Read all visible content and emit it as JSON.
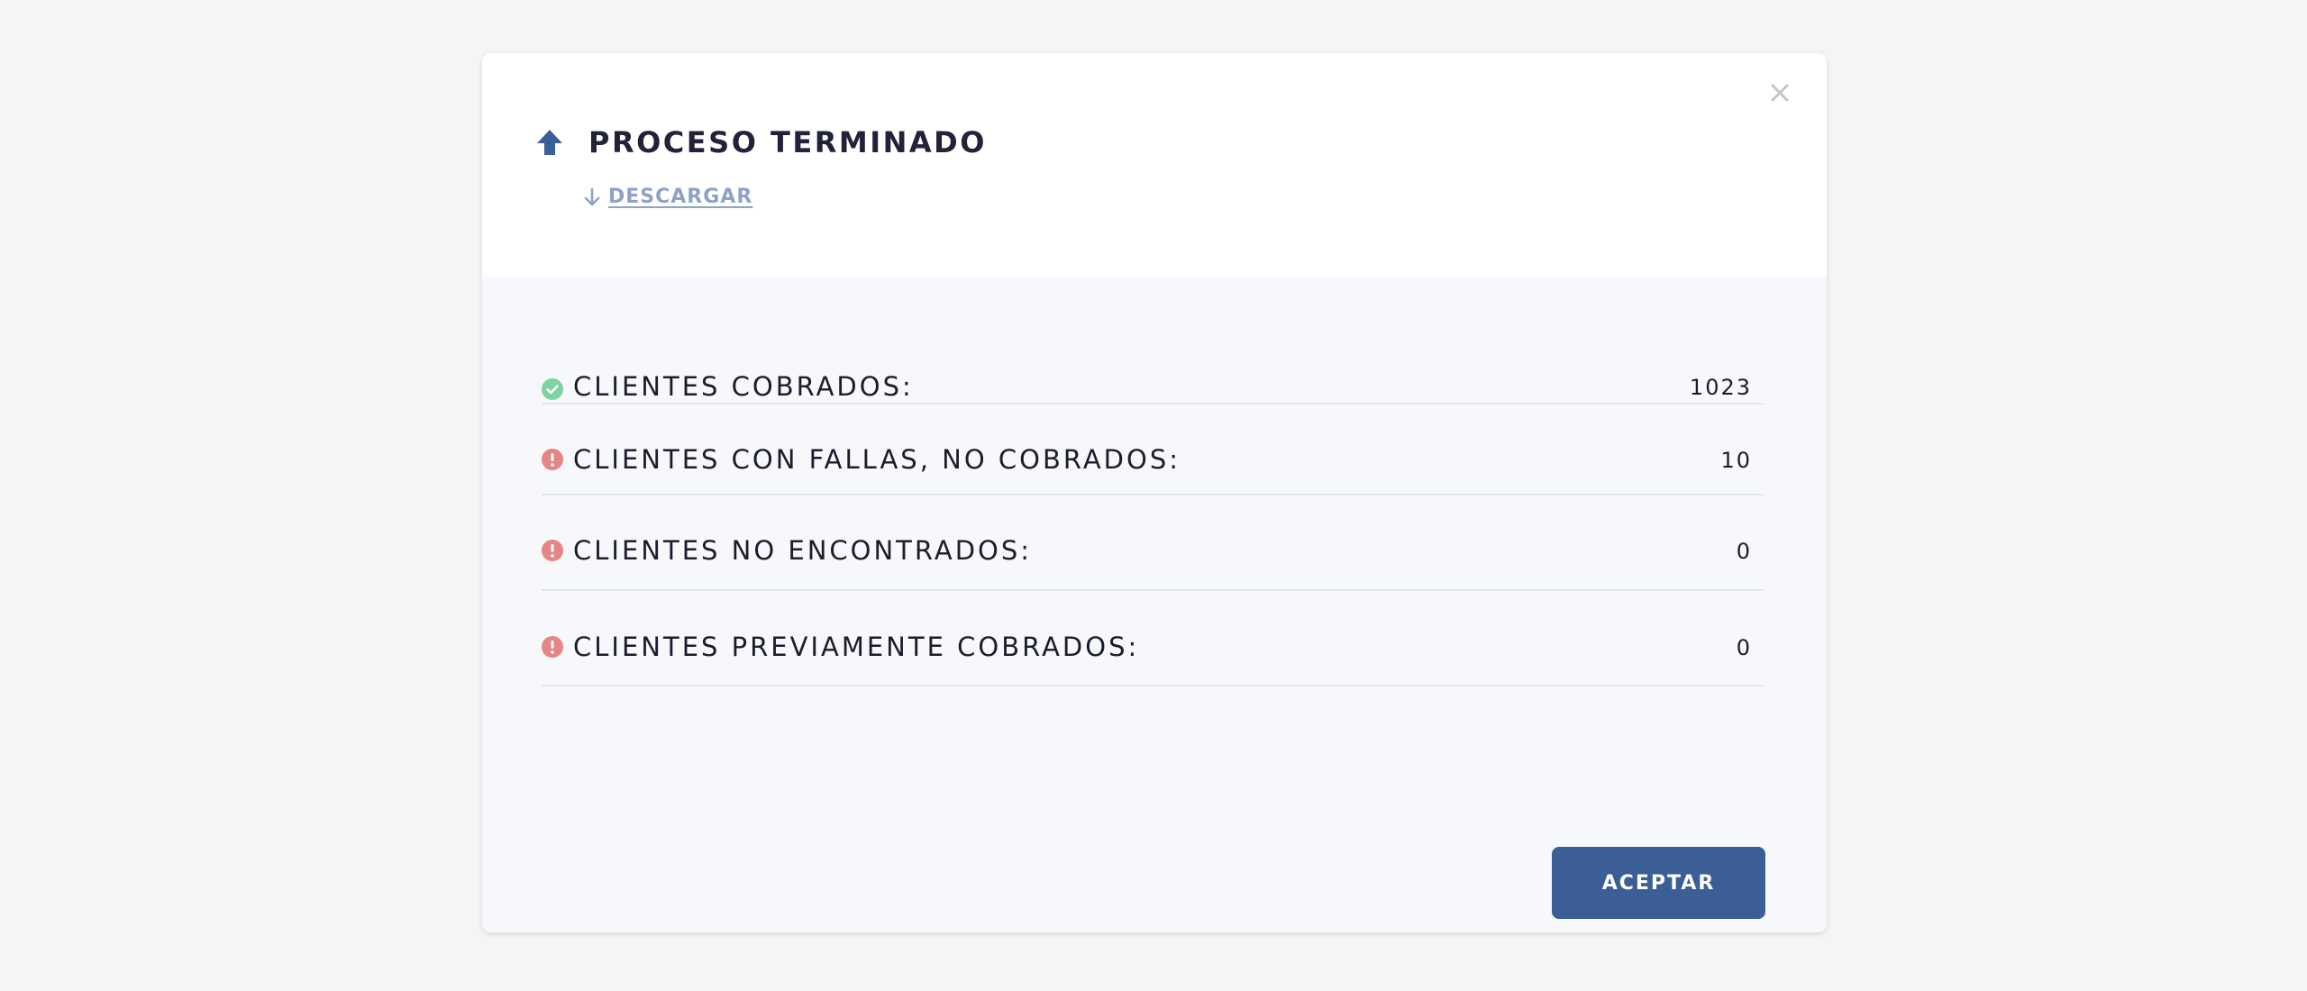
{
  "dialog": {
    "title": "PROCESO TERMINADO",
    "title_icon": "upload-arrow-icon",
    "close_icon": "close-icon",
    "download_label": "DESCARGAR",
    "download_icon": "arrow-down-icon"
  },
  "stats": [
    {
      "label": "CLIENTES COBRADOS:",
      "value": "1023",
      "icon": "check-circle-icon",
      "status": "success"
    },
    {
      "label": "CLIENTES CON FALLAS, NO COBRADOS:",
      "value": "10",
      "icon": "alert-circle-icon",
      "status": "error"
    },
    {
      "label": "CLIENTES NO ENCONTRADOS:",
      "value": "0",
      "icon": "alert-circle-icon",
      "status": "error"
    },
    {
      "label": "CLIENTES PREVIAMENTE COBRADOS:",
      "value": "0",
      "icon": "alert-circle-icon",
      "status": "error"
    }
  ],
  "actions": {
    "accept_label": "ACEPTAR"
  },
  "colors": {
    "primary": "#3b5e97",
    "success": "#7ed3a0",
    "error": "#e58585",
    "link": "#8fa2c6",
    "text": "#1c1c2c"
  }
}
